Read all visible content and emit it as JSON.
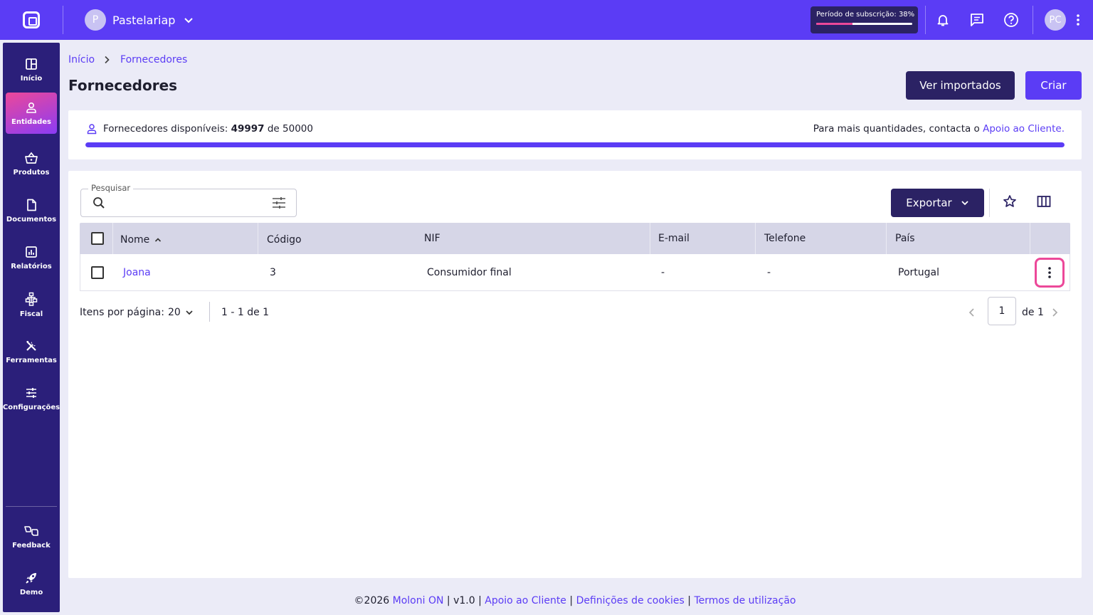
{
  "topbar": {
    "company_initial": "P",
    "company_name": "Pastelariap",
    "subscription_label": "Período de subscrição: 38%",
    "subscription_progress_percent": 38,
    "user_initials": "PC"
  },
  "sidebar": {
    "items": [
      {
        "label": "Início",
        "icon": "grid-icon"
      },
      {
        "label": "Entidades",
        "icon": "user-icon",
        "active": true
      },
      {
        "label": "Produtos",
        "icon": "basket-icon"
      },
      {
        "label": "Documentos",
        "icon": "document-icon"
      },
      {
        "label": "Relatórios",
        "icon": "report-icon"
      },
      {
        "label": "Fiscal",
        "icon": "fiscal-icon"
      },
      {
        "label": "Ferramentas",
        "icon": "tools-icon"
      },
      {
        "label": "Configurações",
        "icon": "settings-icon"
      }
    ],
    "bottom": [
      {
        "label": "Feedback",
        "icon": "feedback-icon"
      },
      {
        "label": "Demo",
        "icon": "rocket-icon"
      }
    ]
  },
  "breadcrumb": {
    "home": "Início",
    "current": "Fornecedores"
  },
  "page": {
    "title": "Fornecedores",
    "btn_imported": "Ver importados",
    "btn_create": "Criar"
  },
  "quota": {
    "label": "Fornecedores disponíveis:",
    "available": "49997",
    "of": "de",
    "total": "50000",
    "fill_percent": 100,
    "note": "Para mais quantidades, contacta o",
    "support_link": "Apoio ao Cliente",
    "note_end": "."
  },
  "toolbar": {
    "search_label": "Pesquisar",
    "search_value": "",
    "export_label": "Exportar"
  },
  "table": {
    "columns": [
      "Nome",
      "Código",
      "NIF",
      "E-mail",
      "Telefone",
      "País"
    ],
    "rows": [
      {
        "nome": "Joana",
        "codigo": "3",
        "nif": "Consumidor final",
        "email": "-",
        "telefone": "-",
        "pais": "Portugal"
      }
    ]
  },
  "pagination": {
    "items_per_page_label": "Itens por página:",
    "items_per_page": "20",
    "range": "1 - 1 de 1",
    "current_page": "1",
    "of_pages": "de 1"
  },
  "footer": {
    "copyright": "©2026",
    "brand": "Moloni ON",
    "version": "v1.0",
    "support": "Apoio ao Cliente",
    "cookies": "Definições de cookies",
    "terms": "Termos de utilização",
    "separator": "|"
  },
  "colors": {
    "primary": "#5b3cf5",
    "dark": "#2b2264",
    "sidebar": "#2b1f7a",
    "highlight": "#ec4899"
  }
}
